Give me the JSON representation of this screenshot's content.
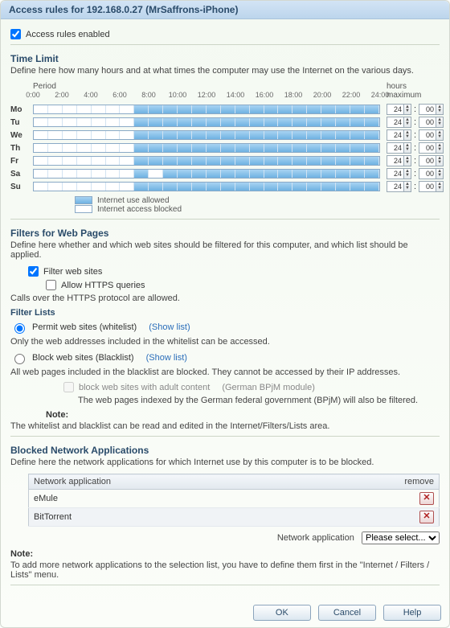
{
  "title": "Access rules for 192.168.0.27 (MrSaffrons-iPhone)",
  "access_rules_enabled": {
    "label": "Access rules enabled",
    "checked": true
  },
  "time_limit": {
    "title": "Time Limit",
    "desc": "Define here how many hours and at what times the computer may use the Internet on the various days.",
    "period_label": "Period",
    "hours_max_label": "hours\nmaximum",
    "ticks": [
      "0:00",
      "2:00",
      "4:00",
      "6:00",
      "8:00",
      "10:00",
      "12:00",
      "14:00",
      "16:00",
      "18:00",
      "20:00",
      "22:00",
      "24:00"
    ],
    "days": [
      {
        "label": "Mo",
        "allowed": [
          [
            7,
            24
          ]
        ],
        "max_h": "24",
        "max_m": "00"
      },
      {
        "label": "Tu",
        "allowed": [
          [
            7,
            24
          ]
        ],
        "max_h": "24",
        "max_m": "00"
      },
      {
        "label": "We",
        "allowed": [
          [
            7,
            24
          ]
        ],
        "max_h": "24",
        "max_m": "00"
      },
      {
        "label": "Th",
        "allowed": [
          [
            7,
            24
          ]
        ],
        "max_h": "24",
        "max_m": "00"
      },
      {
        "label": "Fr",
        "allowed": [
          [
            7,
            24
          ]
        ],
        "max_h": "24",
        "max_m": "00"
      },
      {
        "label": "Sa",
        "allowed": [
          [
            7,
            8
          ],
          [
            9,
            24
          ]
        ],
        "max_h": "24",
        "max_m": "00"
      },
      {
        "label": "Su",
        "allowed": [
          [
            7,
            24
          ]
        ],
        "max_h": "24",
        "max_m": "00"
      }
    ],
    "legend_allowed": "Internet use allowed",
    "legend_blocked": "Internet access blocked"
  },
  "filters": {
    "title": "Filters for Web Pages",
    "desc": "Define here whether and which web sites should be filtered for this computer, and which list should be applied.",
    "filter_sites": {
      "label": "Filter web sites",
      "checked": true
    },
    "allow_https": {
      "label": "Allow HTTPS queries",
      "checked": false,
      "sub": "Calls over the HTTPS protocol are allowed."
    },
    "lists_title": "Filter Lists",
    "whitelist": {
      "label": "Permit web sites (whitelist)",
      "link": "(Show list)",
      "sub": "Only the web addresses included in the whitelist can be accessed.",
      "selected": true
    },
    "blacklist": {
      "label": "Block web sites (Blacklist)",
      "link": "(Show list)",
      "sub": "All web pages included in the blacklist are blocked. They cannot be accessed by their IP addresses.",
      "selected": false
    },
    "bpjm": {
      "label": "block web sites with adult content",
      "suffix": "(German BPjM module)",
      "sub": "The web pages indexed by the German federal government (BPjM) will also be filtered.",
      "checked": false,
      "disabled": true
    },
    "note_label": "Note:",
    "note_text": "The whitelist and blacklist can be read and edited in the Internet/Filters/Lists area."
  },
  "blocked_apps": {
    "title": "Blocked Network Applications",
    "desc": "Define here the network applications for which Internet use by this computer is to be blocked.",
    "col_app": "Network application",
    "col_remove": "remove",
    "rows": [
      {
        "name": "eMule"
      },
      {
        "name": "BitTorrent"
      }
    ],
    "add_label": "Network application",
    "add_placeholder": "Please select...",
    "note_label": "Note:",
    "note_text": "To add more network applications to the selection list, you have to define them first in the \"Internet / Filters / Lists\" menu."
  },
  "buttons": {
    "ok": "OK",
    "cancel": "Cancel",
    "help": "Help"
  }
}
